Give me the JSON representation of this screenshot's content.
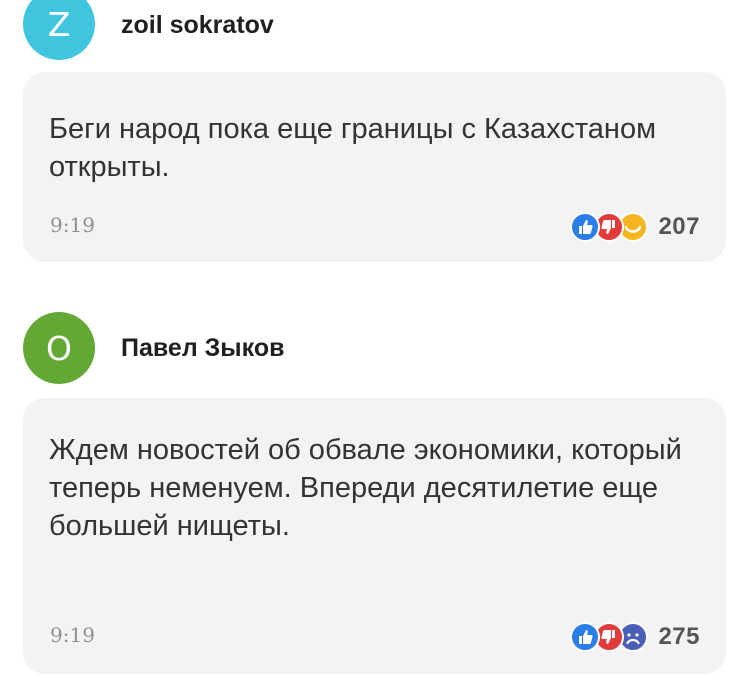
{
  "comments": [
    {
      "avatar_letter": "Z",
      "avatar_color": "#3fc6de",
      "author": "zoil sokratov",
      "text": "Беги народ пока еще границы с Казахстаном открыты.",
      "time": "9:19",
      "reactions": [
        "thumbs-up-icon",
        "thumbs-down-icon",
        "smile-icon"
      ],
      "reaction_count": "207"
    },
    {
      "avatar_letter": "О",
      "avatar_color": "#63a735",
      "author": "Павел Зыков",
      "text": "Ждем новостей об обвале экономики, который теперь неменуем. Впереди десятилетие еще большей нищеты.",
      "time": "9:19",
      "reactions": [
        "thumbs-up-icon",
        "thumbs-down-icon",
        "sad-icon"
      ],
      "reaction_count": "275"
    }
  ],
  "colors": {
    "like": "#2a7ee8",
    "dislike": "#e23b3b",
    "smile": "#f5b51e",
    "sad": "#4b5fb8",
    "bubble": "#f3f3f5"
  }
}
